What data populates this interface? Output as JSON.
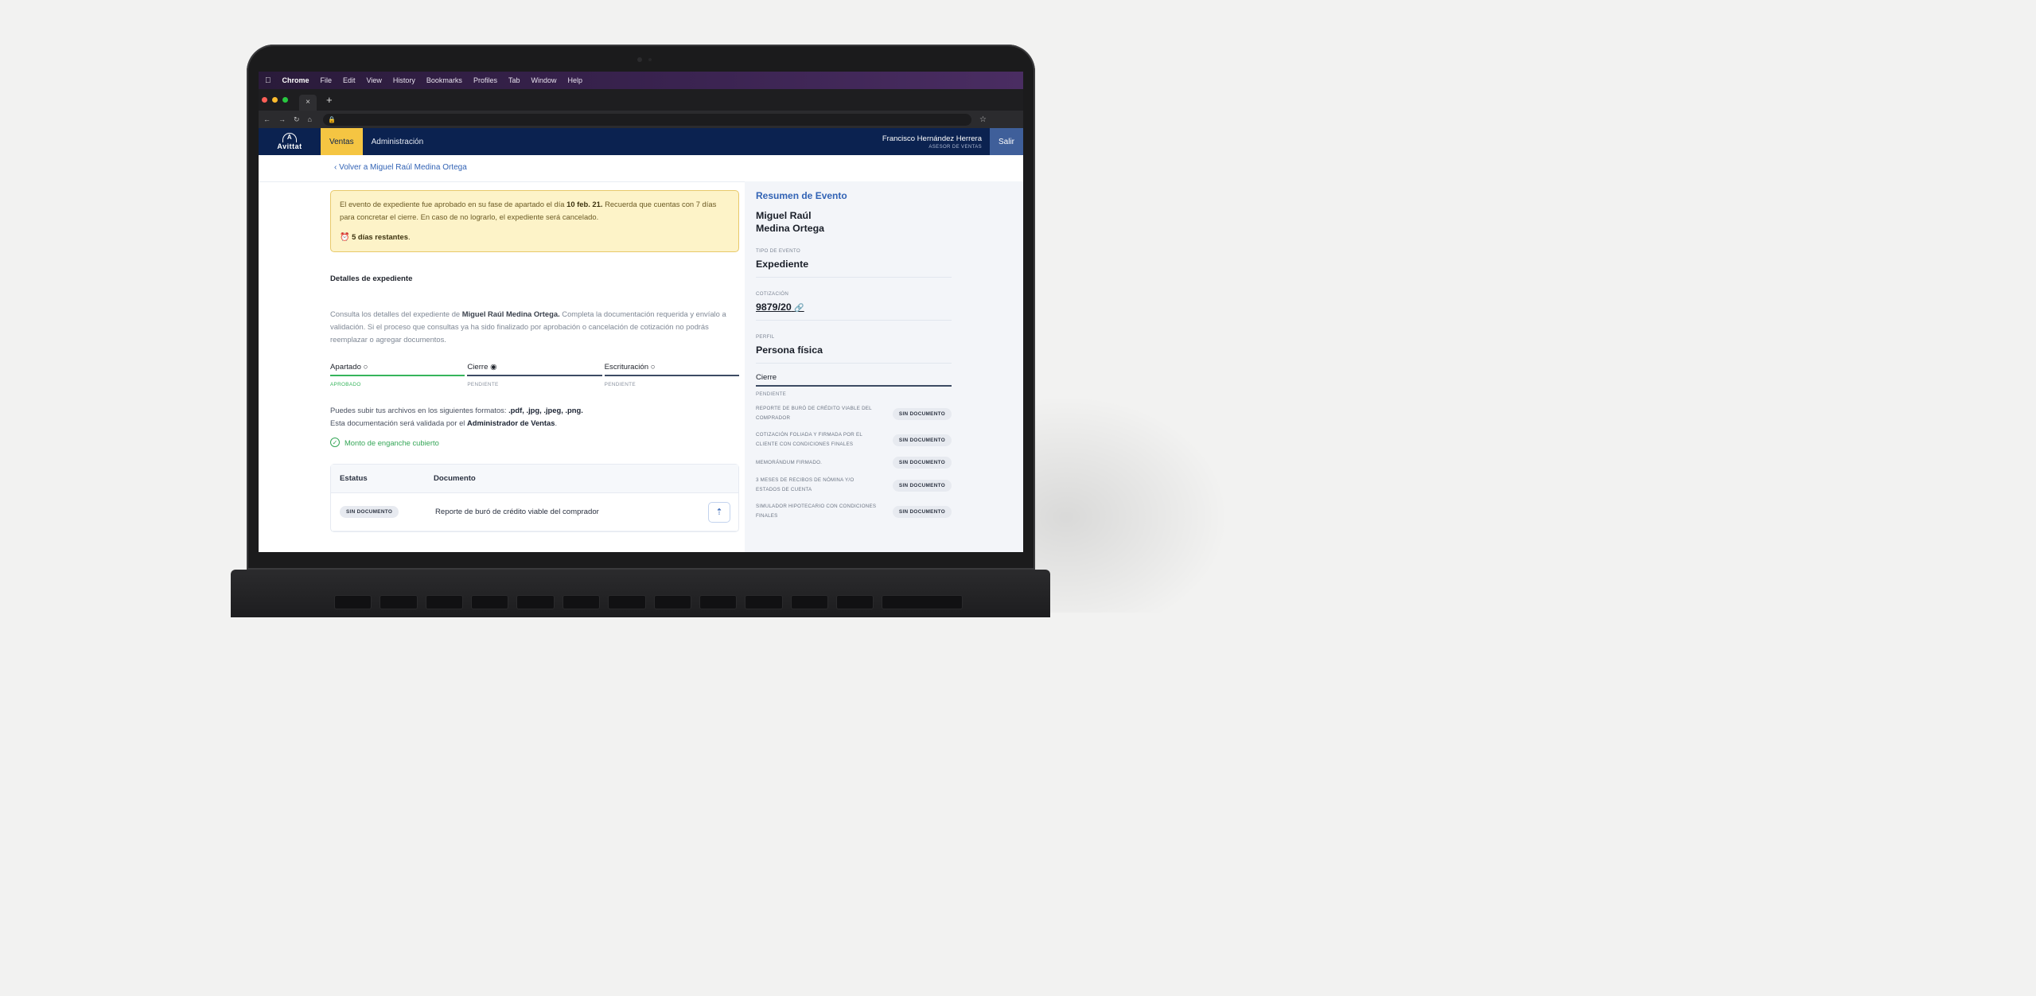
{
  "menubar": {
    "items": [
      "Chrome",
      "File",
      "Edit",
      "View",
      "History",
      "Bookmarks",
      "Profiles",
      "Tab",
      "Window",
      "Help"
    ]
  },
  "browser": {
    "tab_close": "×",
    "new_tab": "+"
  },
  "header": {
    "logo_text": "Avittat",
    "nav": [
      "Ventas",
      "Administración"
    ],
    "active_nav": "Ventas",
    "user_name": "Francisco Hernández Herrera",
    "user_role": "ASESOR DE VENTAS",
    "logout": "Salir"
  },
  "main": {
    "back_link": "Volver a Miguel Raúl Medina Ortega",
    "alert": {
      "text_before": "El evento de expediente fue aprobado en su fase de apartado el día ",
      "date": "10 feb. 21.",
      "text_after": " Recuerda que cuentas con 7 días para concretar el cierre. En caso de no lograrlo, el expediente será cancelado.",
      "days_left": "5 días restantes",
      "days_suffix": "."
    },
    "section_title": "Detalles de expediente",
    "description": {
      "before": "Consulta los detalles del expediente de ",
      "name": "Miguel Raúl Medina Ortega.",
      "after": " Completa la documentación requerida y envíalo a validación. Si el proceso que consultas ya ha sido finalizado por aprobación o cancelación de cotización no podrás reemplazar o agregar documentos."
    },
    "steps": [
      {
        "label": "Apartado ○",
        "status": "APROBADO"
      },
      {
        "label": "Cierre ◉",
        "status": "PENDIENTE"
      },
      {
        "label": "Escrituración ○",
        "status": "PENDIENTE"
      }
    ],
    "formats": {
      "line1_before": "Puedes subir tus archivos en los siguientes formatos: ",
      "line1_formats": ".pdf, .jpg, .jpeg, .png.",
      "line2_before": "Esta documentación será validada por el ",
      "line2_strong": "Administrador de Ventas",
      "line2_after": "."
    },
    "enganche": "Monto de enganche cubierto",
    "table": {
      "headers": [
        "Estatus",
        "Documento"
      ],
      "rows": [
        {
          "status": "SIN DOCUMENTO",
          "document": "Reporte de buró de crédito viable del comprador"
        }
      ]
    }
  },
  "side": {
    "title": "Resumen de Evento",
    "client_line1": "Miguel Raúl",
    "client_line2": "Medina Ortega",
    "fields": [
      {
        "label": "TIPO DE EVENTO",
        "value": "Expediente"
      },
      {
        "label": "COTIZACIÓN",
        "value": "9879/20"
      },
      {
        "label": "PERFIL",
        "value": "Persona física"
      }
    ],
    "cierre_label": "Cierre",
    "cierre_status": "PENDIENTE",
    "requirements": [
      {
        "text": "REPORTE DE BURÓ DE CRÉDITO VIABLE DEL COMPRADOR",
        "status": "SIN DOCUMENTO"
      },
      {
        "text": "COTIZACIÓN FOLIADA Y FIRMADA POR EL CLIENTE CON CONDICIONES FINALES",
        "status": "SIN DOCUMENTO"
      },
      {
        "text": "MEMORÁNDUM FIRMADO.",
        "status": "SIN DOCUMENTO"
      },
      {
        "text": "3 MESES DE RECIBOS DE NÓMINA Y/O ESTADOS DE CUENTA",
        "status": "SIN DOCUMENTO"
      },
      {
        "text": "SIMULADOR HIPOTECARIO CON CONDICIONES FINALES",
        "status": "SIN DOCUMENTO"
      }
    ]
  },
  "colors": {
    "header_bg": "#0b2250",
    "active_tab": "#f5c542",
    "accent_blue": "#3263b5",
    "success": "#35b45b",
    "alert_bg": "#fdf3c8"
  }
}
